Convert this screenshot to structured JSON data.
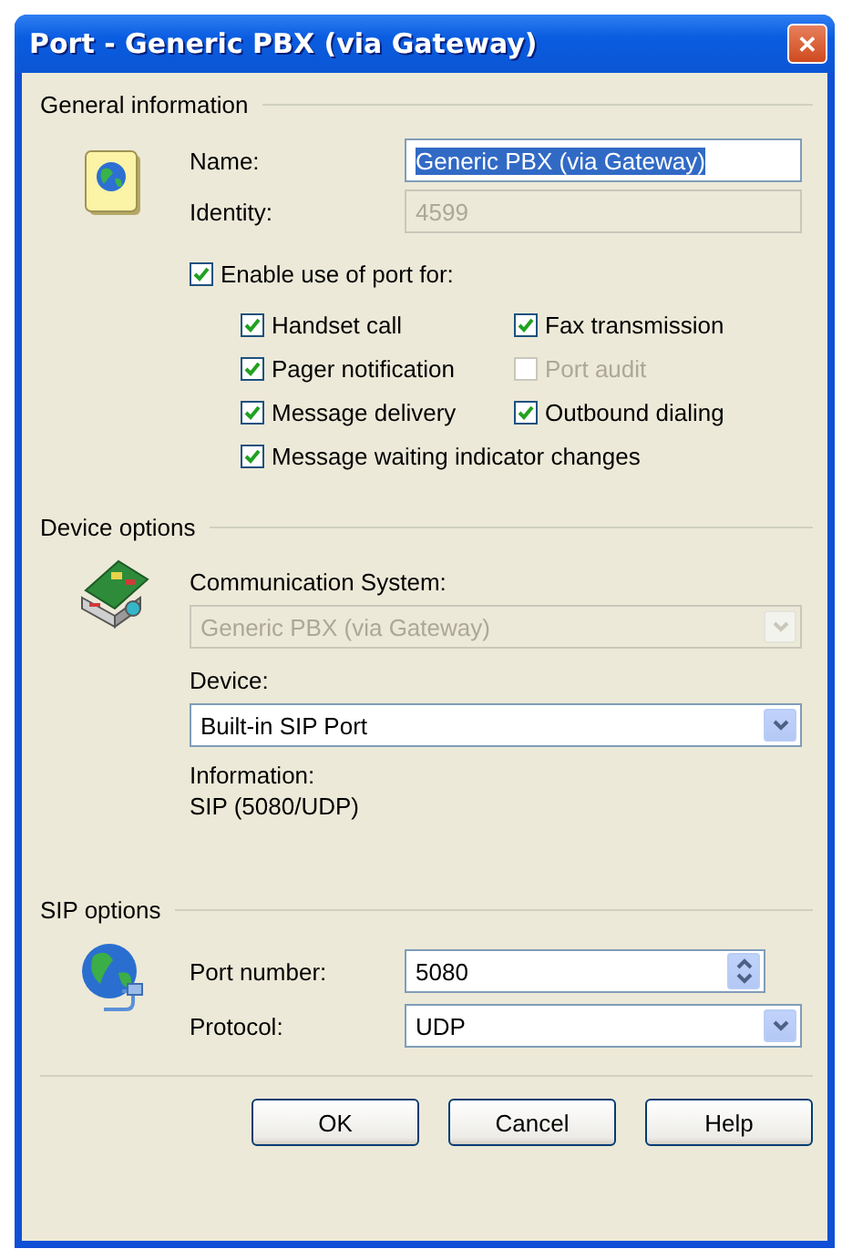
{
  "window": {
    "title": "Port - Generic PBX (via Gateway)",
    "close_symbol": "✕"
  },
  "general_information": {
    "heading": "General information",
    "name": {
      "label": "Name:",
      "value": "Generic PBX (via Gateway)",
      "highlighted": true
    },
    "identity": {
      "label": "Identity:",
      "value": "4599",
      "disabled": true
    },
    "enable_use": {
      "label": "Enable use of port for:",
      "checked": true,
      "disabled": false
    },
    "options": [
      {
        "label": "Handset call",
        "checked": true,
        "disabled": false
      },
      {
        "label": "Fax transmission",
        "checked": true,
        "disabled": false
      },
      {
        "label": "Pager notification",
        "checked": true,
        "disabled": false
      },
      {
        "label": "Port audit",
        "checked": false,
        "disabled": true
      },
      {
        "label": "Message delivery",
        "checked": true,
        "disabled": false
      },
      {
        "label": "Outbound dialing",
        "checked": true,
        "disabled": false
      },
      {
        "label": "Message waiting indicator changes",
        "checked": true,
        "disabled": false
      }
    ]
  },
  "device_options": {
    "heading": "Device options",
    "communication_system": {
      "label": "Communication System:",
      "value": "Generic PBX (via Gateway)",
      "disabled": true
    },
    "device": {
      "label": "Device:",
      "value": "Built-in SIP Port",
      "disabled": false
    },
    "information": {
      "label": "Information:",
      "value": "SIP (5080/UDP)"
    }
  },
  "sip_options": {
    "heading": "SIP options",
    "port_number": {
      "label": "Port number:",
      "value": "5080"
    },
    "protocol": {
      "label": "Protocol:",
      "value": "UDP",
      "disabled": false
    }
  },
  "buttons": [
    {
      "label": "OK"
    },
    {
      "label": "Cancel"
    },
    {
      "label": "Help"
    }
  ]
}
